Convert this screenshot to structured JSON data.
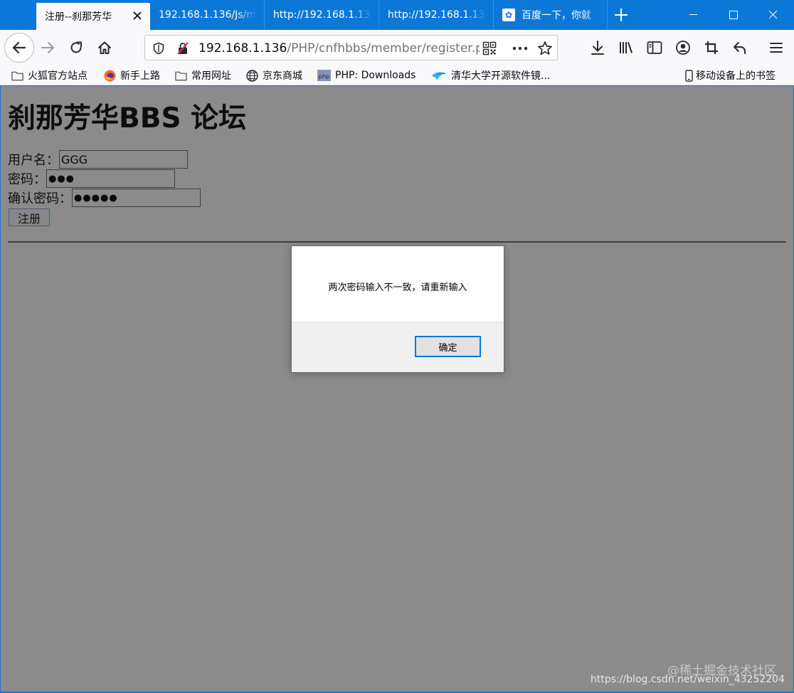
{
  "tabs": [
    {
      "label": "注册--刹那芳华",
      "active": true
    },
    {
      "label": "192.168.1.136/Js/m",
      "active": false
    },
    {
      "label": "http://192.168.1.13",
      "active": false
    },
    {
      "label": "http://192.168.1.13",
      "active": false
    },
    {
      "label": "百度一下，你就",
      "active": false,
      "icon": "baidu-paw-icon"
    }
  ],
  "url": {
    "host": "192.168.1.136",
    "path": "/PHP/cnfhbbs/member/register.php"
  },
  "bookmarks": [
    {
      "label": "火狐官方站点",
      "icon": "folder-icon"
    },
    {
      "label": "新手上路",
      "icon": "firefox-icon"
    },
    {
      "label": "常用网址",
      "icon": "folder-icon"
    },
    {
      "label": "京东商城",
      "icon": "globe-icon"
    },
    {
      "label": "PHP: Downloads",
      "icon": "php-icon"
    },
    {
      "label": "清华大学开源软件镜...",
      "icon": "tuna-icon"
    }
  ],
  "mobile_bookmarks": "移动设备上的书签",
  "page": {
    "title": "刹那芳华BBS 论坛",
    "username_label": "用户名：",
    "username_value": "GGG",
    "password_label": "密码：",
    "password_mask": "●●●",
    "confirm_label": "确认密码：",
    "confirm_mask": "●●●●●",
    "submit_label": "注册"
  },
  "dialog": {
    "message": "两次密码输入不一致，请重新输入",
    "ok_label": "确定"
  },
  "watermark": {
    "brand": "@稀土掘金技术社区",
    "url": "https://blog.csdn.net/weixin_43252204"
  },
  "colors": {
    "titlebar": "#0b78d7",
    "page_overlay": "#8b8b8b",
    "dialog_button_border": "#0a78d7"
  }
}
